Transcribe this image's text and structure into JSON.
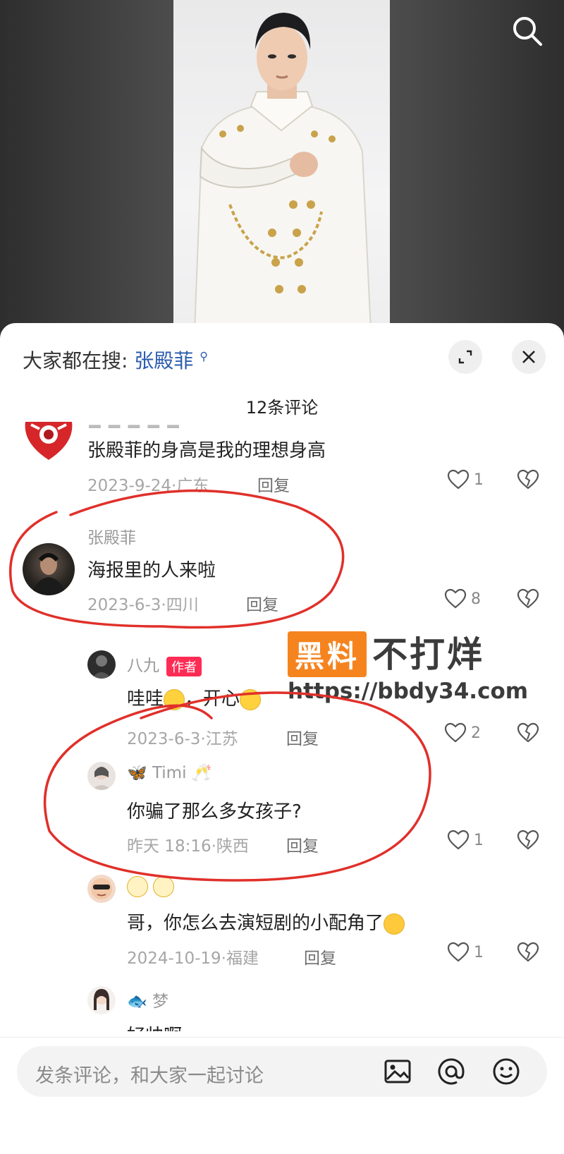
{
  "hot_search": {
    "prefix": "大家都在搜:",
    "keyword": "张殿菲",
    "keyword_icon": "search-icon"
  },
  "comment_count": "12条评论",
  "comments": [
    {
      "text": "张殿菲的身高是我的理想身高",
      "meta": "2023-9-24·广东",
      "reply": "回复",
      "likes": "1"
    },
    {
      "username": "张殿菲",
      "text": "海报里的人来啦",
      "meta": "2023-6-3·四川",
      "reply": "回复",
      "likes": "8"
    },
    {
      "username": "八九",
      "badge": "作者",
      "text_a": "哇哇",
      "text_b": "，开心",
      "meta": "2023-6-3·江苏",
      "reply": "回复",
      "likes": "2"
    },
    {
      "username": "Timi",
      "text": "你骗了那么多女孩子?",
      "meta": "昨天 18:16·陕西",
      "reply": "回复",
      "likes": "1"
    },
    {
      "text": "哥，你怎么去演短剧的小配角了",
      "meta": "2024-10-19·福建",
      "reply": "回复",
      "likes": "1"
    },
    {
      "username": "梦",
      "text": "好帅啊"
    }
  ],
  "watermark": {
    "box_text": "黑料",
    "text": "不打烊",
    "url": "https://bbdy34.com"
  },
  "input": {
    "placeholder": "发条评论，和大家一起讨论"
  },
  "colors": {
    "accent_link": "#2b5cad",
    "author_badge": "#fe2c55",
    "annotation_red": "#e0302a",
    "watermark_orange": "#f5841f"
  }
}
